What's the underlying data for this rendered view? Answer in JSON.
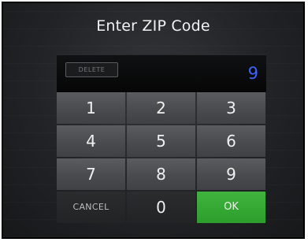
{
  "dialog": {
    "title": "Enter ZIP Code"
  },
  "display": {
    "delete_label": "DELETE",
    "entered_value": "9"
  },
  "keys": {
    "k1": "1",
    "k2": "2",
    "k3": "3",
    "k4": "4",
    "k5": "5",
    "k6": "6",
    "k7": "7",
    "k8": "8",
    "k9": "9",
    "cancel": "CANCEL",
    "k0": "0",
    "ok": "OK"
  },
  "colors": {
    "ok_green": "#35a834",
    "entry_blue": "#3d63ff",
    "background": "#222326",
    "key_gray": "#4c4d50"
  }
}
